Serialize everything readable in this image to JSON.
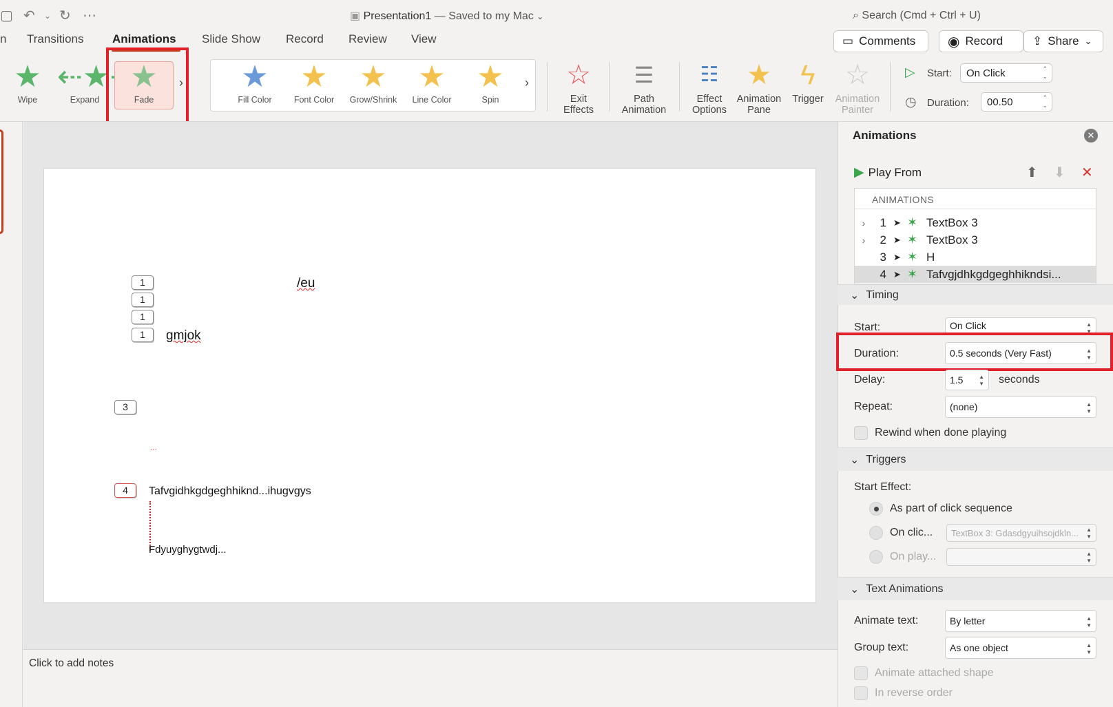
{
  "titlebar": {
    "doc_title": "Presentation1",
    "saved_status": "— Saved to my Mac",
    "search_placeholder": "Search (Cmd + Ctrl + U)"
  },
  "tabs": [
    {
      "label": "n"
    },
    {
      "label": "Transitions"
    },
    {
      "label": "Animations"
    },
    {
      "label": "Slide Show"
    },
    {
      "label": "Record"
    },
    {
      "label": "Review"
    },
    {
      "label": "View"
    }
  ],
  "header_buttons": {
    "comments": "Comments",
    "record": "Record",
    "share": "Share"
  },
  "entrance_gallery": {
    "items": [
      {
        "label": "Wipe"
      },
      {
        "label": "Expand"
      },
      {
        "label": "Fade"
      }
    ]
  },
  "emphasis_gallery": {
    "items": [
      {
        "label": "Fill Color"
      },
      {
        "label": "Font Color"
      },
      {
        "label": "Grow/Shrink"
      },
      {
        "label": "Line Color"
      },
      {
        "label": "Spin"
      }
    ]
  },
  "ribbon_buttons": {
    "exit_effects": [
      "Exit",
      "Effects"
    ],
    "path_animation": [
      "Path",
      "Animation"
    ],
    "effect_options": [
      "Effect",
      "Options"
    ],
    "animation_pane": [
      "Animation",
      "Pane"
    ],
    "trigger": "Trigger",
    "animation_painter": [
      "Animation",
      "Painter"
    ]
  },
  "timing_ribbon": {
    "start_label": "Start:",
    "start_value": "On Click",
    "duration_label": "Duration:",
    "duration_value": "00.50"
  },
  "slide": {
    "tags": [
      "1",
      "1",
      "1",
      "1",
      "3",
      "4"
    ],
    "text_fragment_1": "/eu",
    "text_fragment_2": "gmjok",
    "text_fragment_4": "Tafvgidhkgdgeghhiknd...ihugvgys",
    "text_fragment_5": "Fdyuyghygtwdj..."
  },
  "notes": {
    "placeholder": "Click to add notes"
  },
  "pane": {
    "title": "Animations",
    "play_from": "Play From",
    "list_header": "ANIMATIONS",
    "rows": [
      {
        "num": "1",
        "name": "TextBox 3"
      },
      {
        "num": "2",
        "name": "TextBox 3"
      },
      {
        "num": "3",
        "name": "H"
      },
      {
        "num": "4",
        "name": "Tafvgjdhkgdgeghhikndsi..."
      }
    ],
    "timing": {
      "section": "Timing",
      "start_label": "Start:",
      "start_value": "On Click",
      "duration_label": "Duration:",
      "duration_value": "0.5 seconds (Very Fast)",
      "delay_label": "Delay:",
      "delay_value": "1.5",
      "delay_unit": "seconds",
      "repeat_label": "Repeat:",
      "repeat_value": "(none)",
      "rewind_label": "Rewind when done playing"
    },
    "triggers": {
      "section": "Triggers",
      "start_effect_label": "Start Effect:",
      "option_sequence": "As part of click sequence",
      "option_click": "On clic...",
      "click_target": "TextBox 3: Gdasdgyuihsojdkln...",
      "option_play": "On play..."
    },
    "text_animations": {
      "section": "Text Animations",
      "animate_label": "Animate text:",
      "animate_value": "By letter",
      "group_label": "Group text:",
      "group_value": "As one object",
      "attached_shape": "Animate attached shape",
      "reverse_order": "In reverse order"
    }
  },
  "colors": {
    "accent": "#c43e1c",
    "highlight_box": "#e0212b",
    "star_green": "#3aa64a"
  }
}
